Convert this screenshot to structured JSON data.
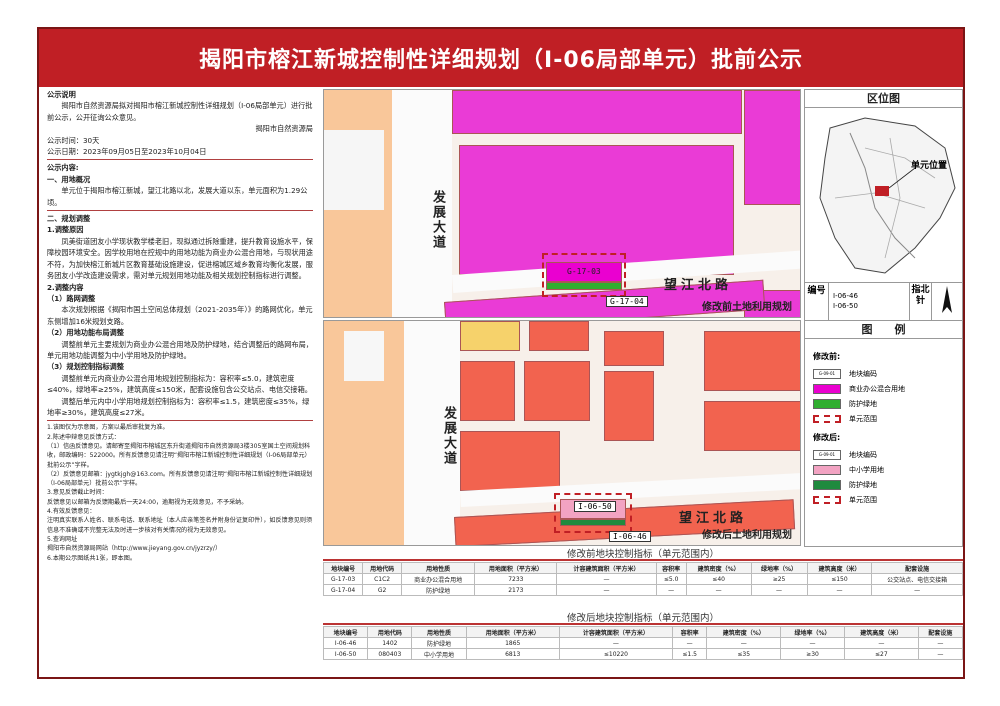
{
  "title": "揭阳市榕江新城控制性详细规划（I-06局部单元）批前公示",
  "notice": {
    "heading": "公示说明",
    "body": "揭阳市自然资源局拟对揭阳市榕江新城控制性详细规划（I-06局部单元）进行批前公示，公开征询公众意见。",
    "issuer": "揭阳市自然资源局",
    "duration": "公示时间：30天",
    "dates": "公示日期：2023年09月05日至2023年10月04日",
    "content_heading": "公示内容:",
    "s1_heading": "一、用地概况",
    "s1_body": "单元位于揭阳市榕江新城，望江北路以北，发展大道以东，单元面积为1.29公顷。",
    "s2_heading": "二、规划调整",
    "s2_1": "1.调整原因",
    "s2_1_body": "凤美街道团友小学现状教学楼老旧，现拟通过拆除重建，提升教育设施水平，保障校园环境安全。因学校用地在控规中的用地功能为商业办公混合用地，与现状用途不符，为加快榕江新城片区教育基础设施建设，促进榕城区域乡教育均衡化发展，服务团友小学改造建设需求，需对单元规划用地功能及相关规划控制指标进行调整。",
    "s2_2": "2.调整内容",
    "s2_2_1": "（1）路网调整",
    "s2_2_1_body": "本次规划根据《揭阳市国土空间总体规划（2021-2035年）》的路网优化，单元东侧增加16米规划支路。",
    "s2_2_2": "（2）用地功能布局调整",
    "s2_2_2_body": "调整前单元主要规划为商业办公混合用地及防护绿地，结合调整后的路网布局，单元用地功能调整为中小学用地及防护绿地。",
    "s2_2_3": "（3）规划控制指标调整",
    "s2_2_3_body1": "调整前单元内商业办公混合用地规划控制指标为：容积率≤5.0，建筑密度≤40%，绿地率≥25%，建筑高度≤150米，配套设施包含公交站点、电信交接箱。",
    "s2_2_3_body2": "调整后单元内中小学用地规划控制指标为：容积率≤1.5，建筑密度≤35%，绿地率≥30%，建筑高度≤27米。",
    "notes": [
      "1.该图仅为示意图，方案以最后审批复为准。",
      "2.陈述申辩意见反馈方式：",
      "（1）信函反馈意见。请邮寄至揭阳市榕城区东升街道揭阳市自然资源局3楼305室国土空间规划科收，邮政编码：522000。所有反馈意见请注明“揭阳市榕江新城控制性详细规划（I-06局部单元）批前公示”字样。",
      "（2）反馈意见邮箱：jygtkjgh@163.com。所有反馈意见请注明“揭阳市榕江新城控制性详细规划（I-06局部单元）批前公示”字样。",
      "3.意见反馈截止时间：",
      "反馈意见以邮箱为反馈期最后一天24:00，逾期视为无效意见，不予采纳。",
      "4.有效反馈意见：",
      "注明真实联系人姓名、联系电话、联系地址（本人应亲笔签名并附身份证复印件），如反馈意见则须信息不准确或不完整无法及时进一步核对有关情况的视为无效意见。",
      "5.查询网址",
      "揭阳市自然资源局网站（http://www.jieyang.gov.cn/jyzrzy/）",
      "6.本期公示图纸共1张，即本图。"
    ]
  },
  "map_before": {
    "caption": "修改前土地利用规划",
    "road_v": "发展大道",
    "road_h": "望江北路",
    "code_a": "G-17-03",
    "code_b": "G-17-04"
  },
  "map_after": {
    "caption": "修改后土地利用规划",
    "road_v": "发展大道",
    "road_h": "望江北路",
    "code_a": "I-06-50",
    "code_b": "I-06-46"
  },
  "right": {
    "location_title": "区位图",
    "location_label": "单元位置",
    "bianhao_label": "编号",
    "bianhao_1": "I-06-46",
    "bianhao_2": "I-06-50",
    "north_label": "指北针",
    "legend_title": "图　　例",
    "before_title": "修改前:",
    "after_title": "修改后:",
    "before_items": [
      {
        "sw": "G-09-01",
        "label": "地块编码",
        "color": "#ffffff"
      },
      {
        "sw": "",
        "label": "商业办公混合用地",
        "color": "#ea00d0"
      },
      {
        "sw": "",
        "label": "防护绿地",
        "color": "#2fae2f"
      },
      {
        "sw": "",
        "label": "单元范围",
        "color": "dash"
      }
    ],
    "after_items": [
      {
        "sw": "G-09-01",
        "label": "地块编码",
        "color": "#ffffff"
      },
      {
        "sw": "",
        "label": "中小学用地",
        "color": "#f2a3c2"
      },
      {
        "sw": "",
        "label": "防护绿地",
        "color": "#1f8a3e"
      },
      {
        "sw": "",
        "label": "单元范围",
        "color": "dash"
      }
    ]
  },
  "table_before": {
    "title": "修改前地块控制指标（单元范围内）",
    "headers": [
      "地块编号",
      "用地代码",
      "用地性质",
      "用地面积（平方米）",
      "计容建筑面积（平方米）",
      "容积率",
      "建筑密度（%）",
      "绿地率（%）",
      "建筑高度（米）",
      "配套设施"
    ],
    "rows": [
      [
        "G-17-03",
        "C1C2",
        "商业办公混合用地",
        "7233",
        "—",
        "≤5.0",
        "≤40",
        "≥25",
        "≤150",
        "公交站点、电信交接箱"
      ],
      [
        "G-17-04",
        "G2",
        "防护绿地",
        "2173",
        "—",
        "—",
        "—",
        "—",
        "—",
        "—"
      ]
    ]
  },
  "table_after": {
    "title": "修改后地块控制指标（单元范围内）",
    "headers": [
      "地块编号",
      "用地代码",
      "用地性质",
      "用地面积（平方米）",
      "计容建筑面积（平方米）",
      "容积率",
      "建筑密度（%）",
      "绿地率（%）",
      "建筑高度（米）",
      "配套设施"
    ],
    "rows": [
      [
        "I-06-46",
        "1402",
        "防护绿地",
        "1865",
        "—",
        "—",
        "—",
        "—",
        "—",
        "—"
      ],
      [
        "I-06-50",
        "080403",
        "中小学用地",
        "6813",
        "≤10220",
        "≤1.5",
        "≤35",
        "≥30",
        "≤27",
        "—"
      ]
    ]
  }
}
